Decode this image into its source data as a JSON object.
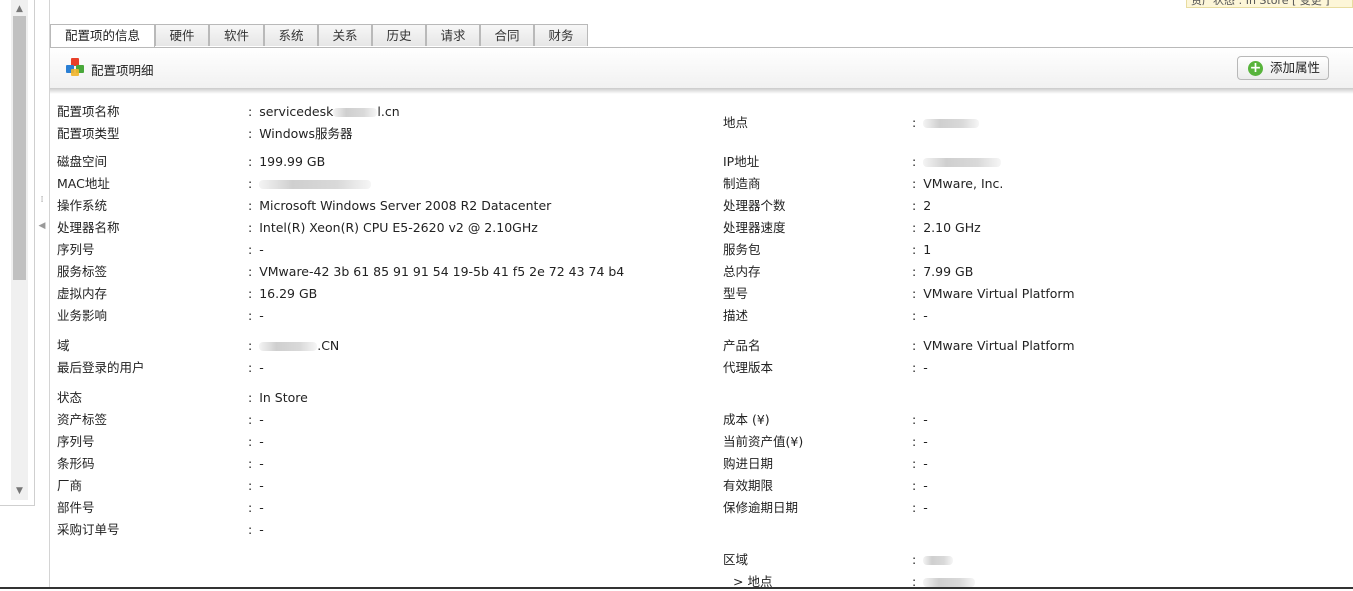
{
  "status_note": "资产状态 : In Store [ 变更 ]",
  "tabs": [
    "配置项的信息",
    "硬件",
    "软件",
    "系统",
    "关系",
    "历史",
    "请求",
    "合同",
    "财务"
  ],
  "header": {
    "title": "配置项明细",
    "add_button": "添加属性"
  },
  "left_fields": [
    {
      "label": "配置项名称",
      "value": "servicedesk",
      "value_suffix": "l.cn",
      "blurred": true
    },
    {
      "label": "配置项类型",
      "value": "Windows服务器"
    },
    {
      "label": "磁盘空间",
      "value": "199.99 GB"
    },
    {
      "label": "MAC地址",
      "value": "",
      "blurred": true
    },
    {
      "label": "操作系统",
      "value": "Microsoft Windows Server 2008 R2 Datacenter"
    },
    {
      "label": "处理器名称",
      "value": "Intel(R) Xeon(R) CPU E5-2620 v2 @ 2.10GHz"
    },
    {
      "label": "序列号",
      "value": "-"
    },
    {
      "label": "服务标签",
      "value": "VMware-42 3b 61 85 91 91 54 19-5b 41 f5 2e 72 43 74 b4"
    },
    {
      "label": "虚拟内存",
      "value": "16.29 GB"
    },
    {
      "label": "业务影响",
      "value": "-"
    },
    {
      "label": "域",
      "value": "",
      "value_suffix": ".CN",
      "blurred": true
    },
    {
      "label": "最后登录的用户",
      "value": "-"
    },
    {
      "label": "状态",
      "value": "In Store"
    },
    {
      "label": "资产标签",
      "value": "-"
    },
    {
      "label": "序列号",
      "value": "-"
    },
    {
      "label": "条形码",
      "value": "-"
    },
    {
      "label": "厂商",
      "value": "-"
    },
    {
      "label": "部件号",
      "value": "-"
    },
    {
      "label": "采购订单号",
      "value": "-"
    }
  ],
  "right_fields": [
    {
      "label": "地点",
      "value": "",
      "blurred": true
    },
    {
      "label": "IP地址",
      "value": "",
      "blurred": true
    },
    {
      "label": "制造商",
      "value": "VMware, Inc."
    },
    {
      "label": "处理器个数",
      "value": "2"
    },
    {
      "label": "处理器速度",
      "value": "2.10 GHz"
    },
    {
      "label": "服务包",
      "value": "1"
    },
    {
      "label": "总内存",
      "value": "7.99 GB"
    },
    {
      "label": "型号",
      "value": "VMware Virtual Platform"
    },
    {
      "label": "描述",
      "value": "-"
    },
    {
      "label": "产品名",
      "value": "VMware Virtual Platform"
    },
    {
      "label": "代理版本",
      "value": "-"
    },
    {
      "label": "成本 (¥)",
      "value": "-"
    },
    {
      "label": "当前资产值(¥)",
      "value": "-"
    },
    {
      "label": "购进日期",
      "value": "-"
    },
    {
      "label": "有效期限",
      "value": "-"
    },
    {
      "label": "保修逾期日期",
      "value": "-"
    },
    {
      "label": "区域",
      "value": "",
      "blurred": true
    },
    {
      "label": "> 地点",
      "value": "",
      "blurred": true
    }
  ],
  "colors": {
    "accent_green": "#58b43c",
    "tab_border": "#b9b9b9"
  }
}
